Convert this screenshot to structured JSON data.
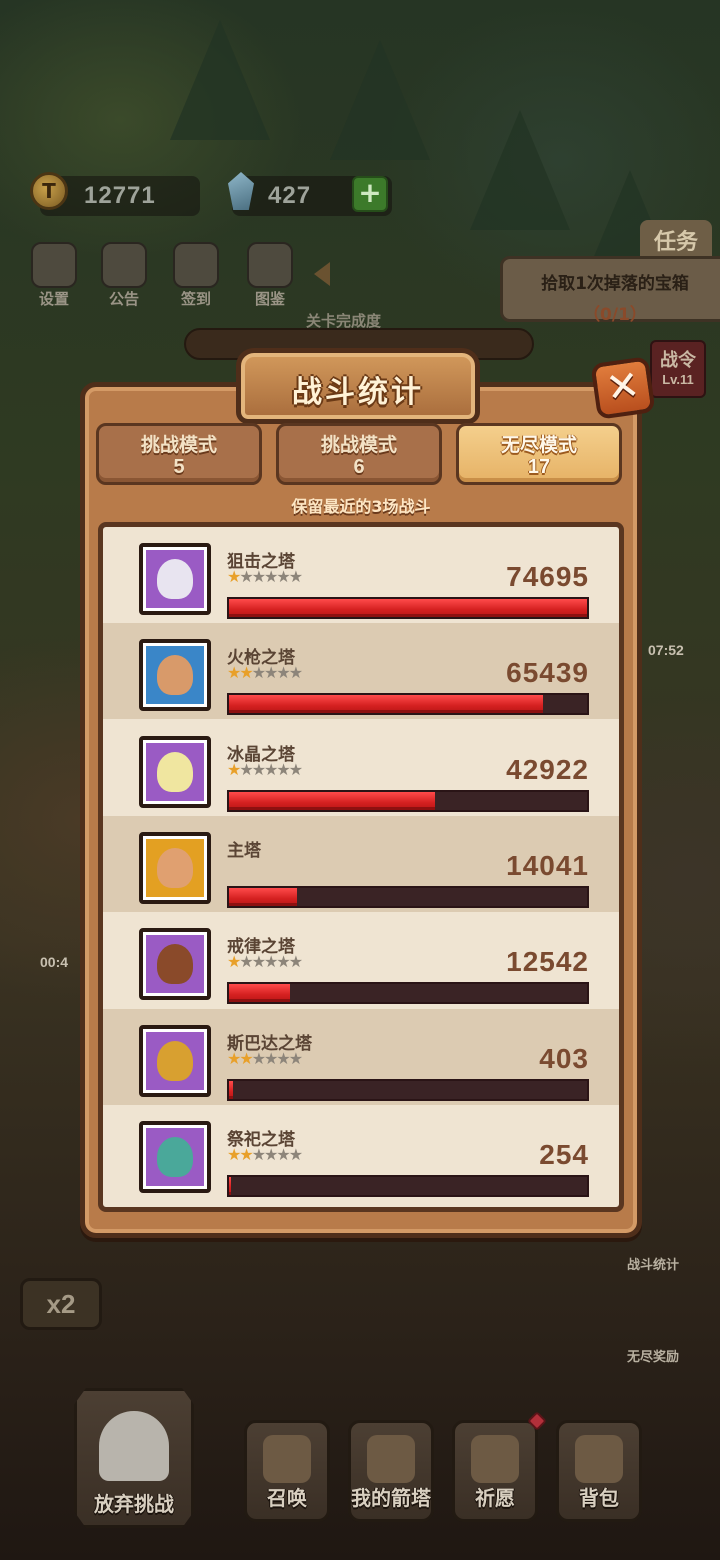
{
  "hud": {
    "gold": "12771",
    "gems": "427",
    "add_label": "+",
    "menu": [
      {
        "label": "设置",
        "icon": "gear-icon"
      },
      {
        "label": "公告",
        "icon": "scroll-icon"
      },
      {
        "label": "签到",
        "icon": "feather-icon"
      },
      {
        "label": "图鉴",
        "icon": "book-icon"
      }
    ],
    "stage_progress_label": "关卡完成度"
  },
  "task": {
    "tag": "任务",
    "text": "拾取1次掉落的宝箱",
    "progress": "（0/1）"
  },
  "battle_pass": {
    "title": "战令",
    "level": "Lv.11"
  },
  "side": {
    "chest_timer": "07:52",
    "left_timer": "00:4",
    "battle_stats_label": "战斗统计",
    "endless_reward_label": "无尽奖励"
  },
  "modal": {
    "title": "战斗统计",
    "close_label": "✕",
    "keep_note": "保留最近的3场战斗",
    "tabs": [
      {
        "label": "挑战模式",
        "sub": "5",
        "active": false
      },
      {
        "label": "挑战模式",
        "sub": "6",
        "active": false
      },
      {
        "label": "无尽模式",
        "sub": "17",
        "active": true
      }
    ],
    "rows": [
      {
        "name": "狙击之塔",
        "damage": "74695",
        "ratio": 1.0,
        "stars": 1,
        "frame": "#9a5bc4",
        "face": "#e8e4f0",
        "show_stars": true
      },
      {
        "name": "火枪之塔",
        "damage": "65439",
        "ratio": 0.876,
        "stars": 2,
        "frame": "#3a86c8",
        "face": "#d89a6a",
        "show_stars": true
      },
      {
        "name": "冰晶之塔",
        "damage": "42922",
        "ratio": 0.575,
        "stars": 1,
        "frame": "#9a5bc4",
        "face": "#f0e6a0",
        "show_stars": true
      },
      {
        "name": "主塔",
        "damage": "14041",
        "ratio": 0.19,
        "stars": 0,
        "frame": "#e3a022",
        "face": "#e0a070",
        "show_stars": false
      },
      {
        "name": "戒律之塔",
        "damage": "12542",
        "ratio": 0.17,
        "stars": 1,
        "frame": "#9a5bc4",
        "face": "#8a4a2a",
        "show_stars": true
      },
      {
        "name": "斯巴达之塔",
        "damage": "403",
        "ratio": 0.01,
        "stars": 2,
        "frame": "#9a5bc4",
        "face": "#d8a030",
        "show_stars": true
      },
      {
        "name": "祭祀之塔",
        "damage": "254",
        "ratio": 0.005,
        "stars": 2,
        "frame": "#9a5bc4",
        "face": "#4aa89a",
        "show_stars": true
      }
    ]
  },
  "bottom": {
    "speed": "x2",
    "nav": [
      {
        "label": "放弃挑战",
        "icon": "axe-icon"
      },
      {
        "label": "召唤",
        "icon": "scroll-icon"
      },
      {
        "label": "我的箭塔",
        "icon": "tower-icon"
      },
      {
        "label": "祈愿",
        "icon": "star-icon"
      },
      {
        "label": "背包",
        "icon": "backpack-icon"
      }
    ]
  }
}
